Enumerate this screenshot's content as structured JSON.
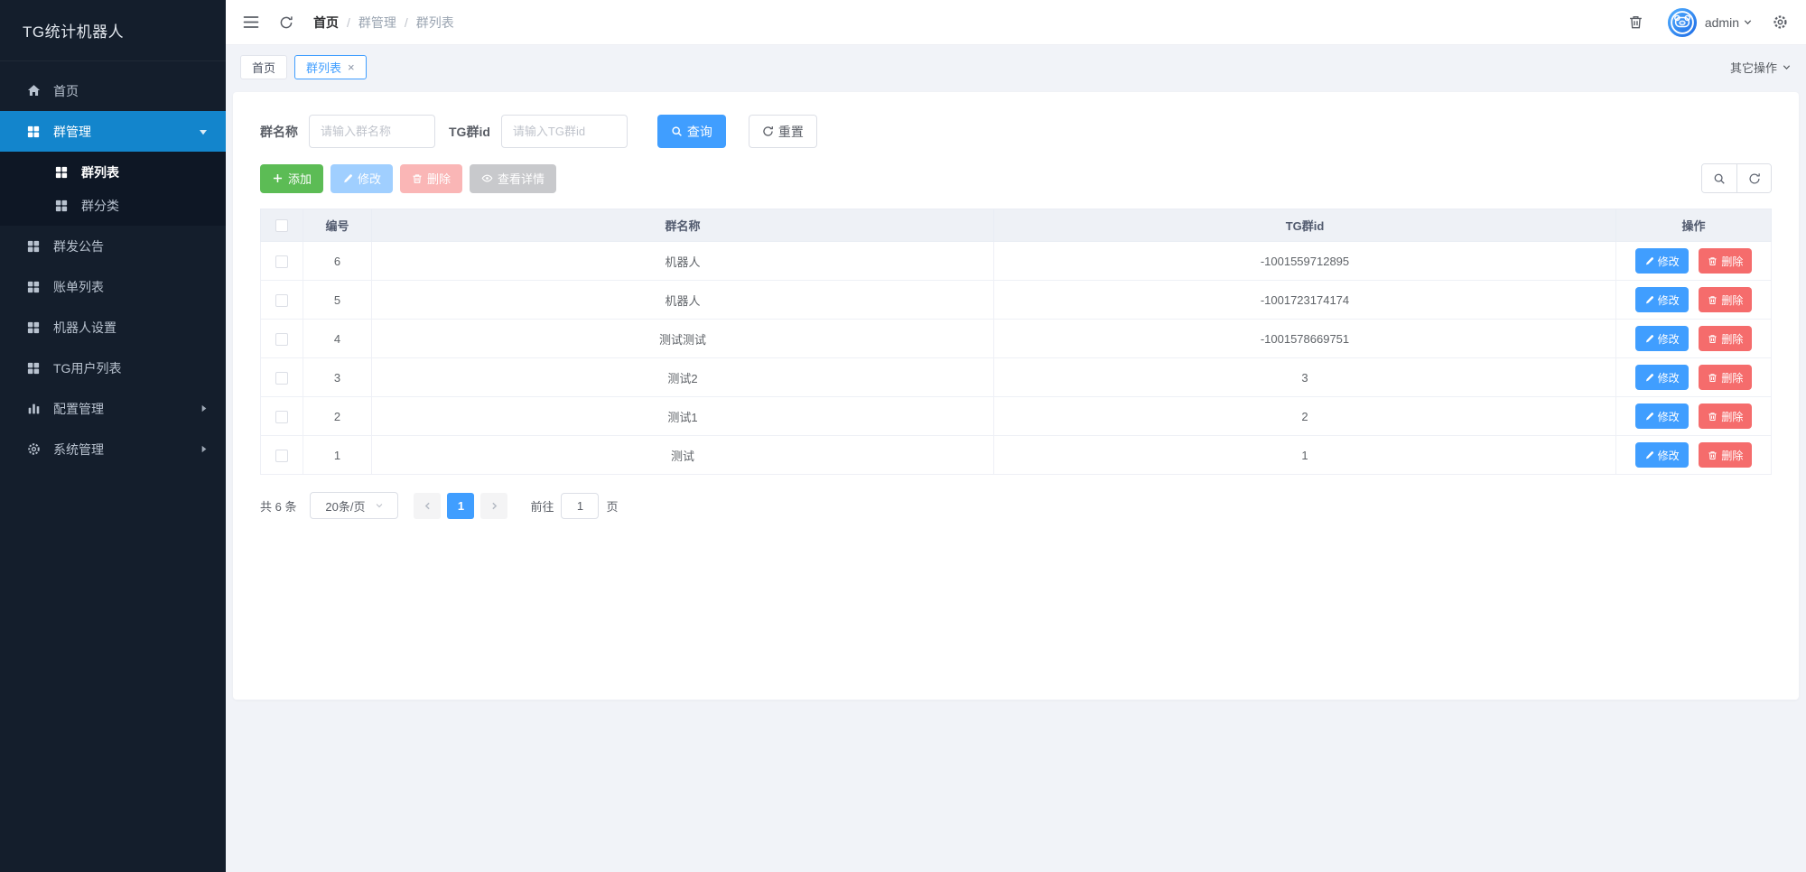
{
  "app": {
    "title": "TG统计机器人"
  },
  "header": {
    "breadcrumb": [
      "首页",
      "群管理",
      "群列表"
    ],
    "username": "admin"
  },
  "tagbar": {
    "tabs": [
      {
        "label": "首页",
        "active": false
      },
      {
        "label": "群列表",
        "active": true,
        "close": "×"
      }
    ],
    "more_label": "其它操作"
  },
  "sidebar": {
    "items": [
      {
        "label": "首页",
        "icon": "home-icon"
      },
      {
        "label": "群管理",
        "icon": "grid-icon",
        "active": true,
        "expanded": true,
        "children": [
          {
            "label": "群列表",
            "icon": "grid-icon",
            "active": true
          },
          {
            "label": "群分类",
            "icon": "grid-icon",
            "active": false
          }
        ]
      },
      {
        "label": "群发公告",
        "icon": "grid-icon"
      },
      {
        "label": "账单列表",
        "icon": "grid-icon"
      },
      {
        "label": "机器人设置",
        "icon": "grid-icon"
      },
      {
        "label": "TG用户列表",
        "icon": "grid-icon"
      },
      {
        "label": "配置管理",
        "icon": "bar-chart-icon",
        "collapsed": true
      },
      {
        "label": "系统管理",
        "icon": "gear-icon",
        "collapsed": true
      }
    ]
  },
  "search": {
    "name_label": "群名称",
    "name_placeholder": "请输入群名称",
    "name_value": "",
    "id_label": "TG群id",
    "id_placeholder": "请输入TG群id",
    "id_value": "",
    "query_label": "查询",
    "reset_label": "重置"
  },
  "toolbar": {
    "add_label": "添加",
    "edit_label": "修改",
    "delete_label": "删除",
    "detail_label": "查看详情"
  },
  "table": {
    "columns": {
      "id": "编号",
      "name": "群名称",
      "tgid": "TG群id",
      "actions": "操作"
    },
    "rows": [
      {
        "id": "6",
        "name": "机器人",
        "tgid": "-1001559712895"
      },
      {
        "id": "5",
        "name": "机器人",
        "tgid": "-1001723174174"
      },
      {
        "id": "4",
        "name": "测试测试",
        "tgid": "-1001578669751"
      },
      {
        "id": "3",
        "name": "测试2",
        "tgid": "3"
      },
      {
        "id": "2",
        "name": "测试1",
        "tgid": "2"
      },
      {
        "id": "1",
        "name": "测试",
        "tgid": "1"
      }
    ],
    "row_edit_label": "修改",
    "row_delete_label": "删除"
  },
  "pagination": {
    "total_label": "共 6 条",
    "page_size_label": "20条/页",
    "current_page": "1",
    "goto_label": "前往",
    "goto_value": "1",
    "page_label": "页"
  },
  "icons": {
    "navbar": [
      "fold-icon",
      "refresh-icon",
      "trash-icon",
      "avatar",
      "chevron-down-icon",
      "gear-icon"
    ],
    "query_button": "search-icon",
    "reset_button": "refresh-icon",
    "add_button": "plus-icon",
    "edit_button": "pencil-icon",
    "delete_button": "trash-icon",
    "detail_button": "eye-icon",
    "table_tools": [
      "search-icon",
      "refresh-icon"
    ]
  },
  "colors": {
    "primary": "#409EFF",
    "sidebar_bg": "#141E2C",
    "sidebar_active_bg": "#1385CC",
    "success": "#5CBC55",
    "danger": "#F56C6C",
    "disabled_primary": "#A0CFFF",
    "disabled_danger": "#FAB6B6",
    "disabled_info": "#C8C9CC",
    "content_bg": "#F1F3F8",
    "table_header_bg": "#EEF1F6"
  }
}
